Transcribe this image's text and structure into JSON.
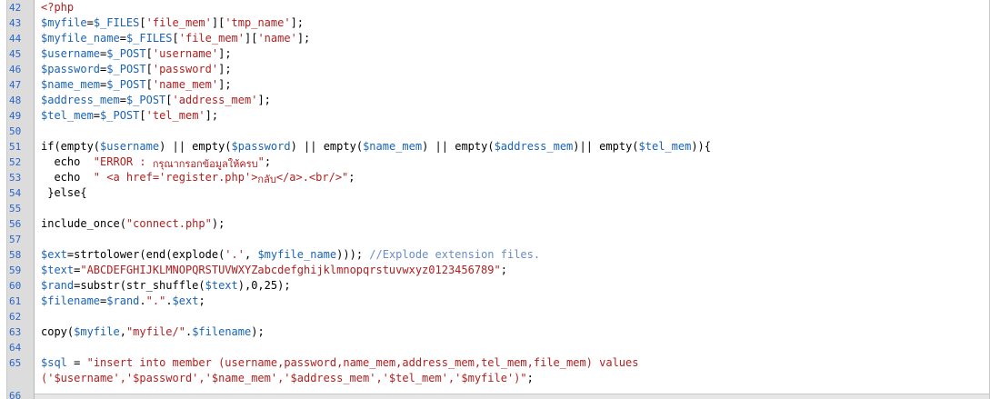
{
  "editor": {
    "lines": [
      {
        "n": "42",
        "t": 0,
        "tokens": [
          {
            "c": "str",
            "s": "<?php"
          }
        ]
      },
      {
        "n": "43",
        "t": 17,
        "tokens": [
          {
            "c": "var",
            "s": "$myfile"
          },
          {
            "c": "kw",
            "s": "="
          },
          {
            "c": "var",
            "s": "$_FILES"
          },
          {
            "c": "kw",
            "s": "["
          },
          {
            "c": "str",
            "s": "'file_mem'"
          },
          {
            "c": "kw",
            "s": "]["
          },
          {
            "c": "str",
            "s": "'tmp_name'"
          },
          {
            "c": "kw",
            "s": "];"
          }
        ]
      },
      {
        "n": "44",
        "t": 34,
        "tokens": [
          {
            "c": "var",
            "s": "$myfile_name"
          },
          {
            "c": "kw",
            "s": "="
          },
          {
            "c": "var",
            "s": "$_FILES"
          },
          {
            "c": "kw",
            "s": "["
          },
          {
            "c": "str",
            "s": "'file_mem'"
          },
          {
            "c": "kw",
            "s": "]["
          },
          {
            "c": "str",
            "s": "'name'"
          },
          {
            "c": "kw",
            "s": "];"
          }
        ]
      },
      {
        "n": "45",
        "t": 51,
        "tokens": [
          {
            "c": "var",
            "s": "$username"
          },
          {
            "c": "kw",
            "s": "="
          },
          {
            "c": "var",
            "s": "$_POST"
          },
          {
            "c": "kw",
            "s": "["
          },
          {
            "c": "str",
            "s": "'username'"
          },
          {
            "c": "kw",
            "s": "];"
          }
        ]
      },
      {
        "n": "46",
        "t": 68,
        "tokens": [
          {
            "c": "var",
            "s": "$password"
          },
          {
            "c": "kw",
            "s": "="
          },
          {
            "c": "var",
            "s": "$_POST"
          },
          {
            "c": "kw",
            "s": "["
          },
          {
            "c": "str",
            "s": "'password'"
          },
          {
            "c": "kw",
            "s": "];"
          }
        ]
      },
      {
        "n": "47",
        "t": 85,
        "tokens": [
          {
            "c": "var",
            "s": "$name_mem"
          },
          {
            "c": "kw",
            "s": "="
          },
          {
            "c": "var",
            "s": "$_POST"
          },
          {
            "c": "kw",
            "s": "["
          },
          {
            "c": "str",
            "s": "'name_mem'"
          },
          {
            "c": "kw",
            "s": "];"
          }
        ]
      },
      {
        "n": "48",
        "t": 102,
        "tokens": [
          {
            "c": "var",
            "s": "$address_mem"
          },
          {
            "c": "kw",
            "s": "="
          },
          {
            "c": "var",
            "s": "$_POST"
          },
          {
            "c": "kw",
            "s": "["
          },
          {
            "c": "str",
            "s": "'address_mem'"
          },
          {
            "c": "kw",
            "s": "];"
          }
        ]
      },
      {
        "n": "49",
        "t": 119,
        "tokens": [
          {
            "c": "var",
            "s": "$tel_mem"
          },
          {
            "c": "kw",
            "s": "="
          },
          {
            "c": "var",
            "s": "$_POST"
          },
          {
            "c": "kw",
            "s": "["
          },
          {
            "c": "str",
            "s": "'tel_mem'"
          },
          {
            "c": "kw",
            "s": "];"
          }
        ]
      },
      {
        "n": "50",
        "t": 136,
        "tokens": []
      },
      {
        "n": "51",
        "t": 153,
        "tokens": [
          {
            "c": "kw",
            "s": "if(empty("
          },
          {
            "c": "var",
            "s": "$username"
          },
          {
            "c": "kw",
            "s": ") || empty("
          },
          {
            "c": "var",
            "s": "$password"
          },
          {
            "c": "kw",
            "s": ") || empty("
          },
          {
            "c": "var",
            "s": "$name_mem"
          },
          {
            "c": "kw",
            "s": ") || empty("
          },
          {
            "c": "var",
            "s": "$address_mem"
          },
          {
            "c": "kw",
            "s": ")|| empty("
          },
          {
            "c": "var",
            "s": "$tel_mem"
          },
          {
            "c": "kw",
            "s": ")){"
          }
        ]
      },
      {
        "n": "52",
        "t": 170,
        "tokens": [
          {
            "c": "kw",
            "s": "  echo  "
          },
          {
            "c": "str",
            "s": "\"ERROR : "
          },
          {
            "c": "thai",
            "s": "กรุณากรอกข้อมูลให้ครบ"
          },
          {
            "c": "str",
            "s": "\""
          },
          {
            "c": "kw",
            "s": ";"
          }
        ]
      },
      {
        "n": "53",
        "t": 187,
        "tokens": [
          {
            "c": "kw",
            "s": "  echo  "
          },
          {
            "c": "str",
            "s": "\" <a href='register.php'>"
          },
          {
            "c": "thai",
            "s": "กลับ"
          },
          {
            "c": "str",
            "s": "</a>.<br/>\""
          },
          {
            "c": "kw",
            "s": ";"
          }
        ]
      },
      {
        "n": "54",
        "t": 204,
        "tokens": [
          {
            "c": "kw",
            "s": " }else{"
          }
        ]
      },
      {
        "n": "55",
        "t": 221,
        "tokens": []
      },
      {
        "n": "56",
        "t": 238,
        "tokens": [
          {
            "c": "kw",
            "s": "include_once("
          },
          {
            "c": "str",
            "s": "\"connect.php\""
          },
          {
            "c": "kw",
            "s": ");"
          }
        ]
      },
      {
        "n": "57",
        "t": 255,
        "tokens": []
      },
      {
        "n": "58",
        "t": 272,
        "tokens": [
          {
            "c": "var",
            "s": "$ext"
          },
          {
            "c": "kw",
            "s": "=strtolower(end(explode("
          },
          {
            "c": "str",
            "s": "'.'"
          },
          {
            "c": "kw",
            "s": ", "
          },
          {
            "c": "var",
            "s": "$myfile_name"
          },
          {
            "c": "kw",
            "s": "))); "
          },
          {
            "c": "cmt",
            "s": "//Explode extension files."
          }
        ]
      },
      {
        "n": "59",
        "t": 289,
        "tokens": [
          {
            "c": "var",
            "s": "$text"
          },
          {
            "c": "kw",
            "s": "="
          },
          {
            "c": "str",
            "s": "\"ABCDEFGHIJKLMNOPQRSTUVWXYZabcdefghijklmnopqrstuvwxyz0123456789\""
          },
          {
            "c": "kw",
            "s": ";"
          }
        ]
      },
      {
        "n": "60",
        "t": 306,
        "tokens": [
          {
            "c": "var",
            "s": "$rand"
          },
          {
            "c": "kw",
            "s": "=substr(str_shuffle("
          },
          {
            "c": "var",
            "s": "$text"
          },
          {
            "c": "kw",
            "s": "),0,25);"
          }
        ]
      },
      {
        "n": "61",
        "t": 323,
        "tokens": [
          {
            "c": "var",
            "s": "$filename"
          },
          {
            "c": "kw",
            "s": "="
          },
          {
            "c": "var",
            "s": "$rand"
          },
          {
            "c": "kw",
            "s": "."
          },
          {
            "c": "str",
            "s": "\".\""
          },
          {
            "c": "kw",
            "s": "."
          },
          {
            "c": "var",
            "s": "$ext"
          },
          {
            "c": "kw",
            "s": ";"
          }
        ]
      },
      {
        "n": "62",
        "t": 340,
        "tokens": []
      },
      {
        "n": "63",
        "t": 357,
        "tokens": [
          {
            "c": "kw",
            "s": "copy("
          },
          {
            "c": "var",
            "s": "$myfile"
          },
          {
            "c": "kw",
            "s": ","
          },
          {
            "c": "str",
            "s": "\"myfile/\""
          },
          {
            "c": "kw",
            "s": "."
          },
          {
            "c": "var",
            "s": "$filename"
          },
          {
            "c": "kw",
            "s": ");"
          }
        ]
      },
      {
        "n": "64",
        "t": 374,
        "tokens": []
      },
      {
        "n": "65",
        "t": 391,
        "tokens": [
          {
            "c": "var",
            "s": "$sql"
          },
          {
            "c": "kw",
            "s": " = "
          },
          {
            "c": "str",
            "s": "\"insert into member (username,password,name_mem,address_mem,tel_mem,file_mem) values"
          }
        ]
      },
      {
        "n": "",
        "t": 408,
        "tokens": [
          {
            "c": "str",
            "s": "('$username','$password','$name_mem','$address_mem','$tel_mem','$myfile')\""
          },
          {
            "c": "kw",
            "s": ";"
          }
        ]
      },
      {
        "n": "66",
        "t": 427,
        "tokens": []
      }
    ]
  }
}
